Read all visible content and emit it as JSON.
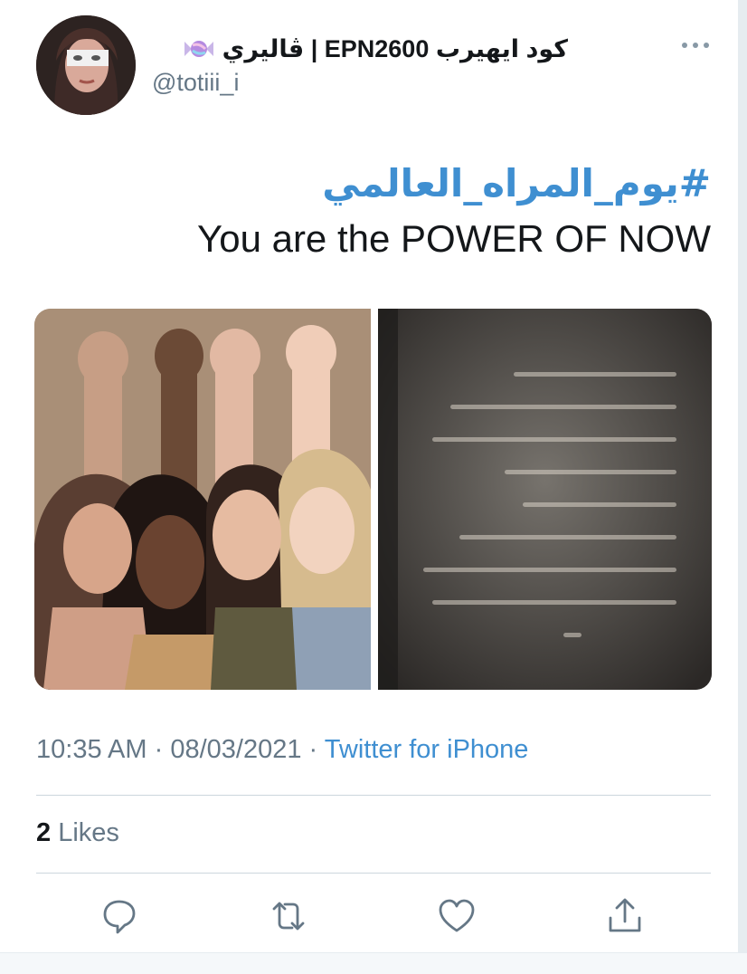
{
  "user": {
    "display_name": "كود ايهيرب EPN2600 | ڤاليري",
    "handle": "@totiii_i"
  },
  "tweet": {
    "hashtag": "#يوم_المراه_العالمي",
    "text": "You are the POWER OF NOW"
  },
  "meta": {
    "time": "10:35 AM",
    "separator": "·",
    "date": "08/03/2021",
    "source": "Twitter for iPhone"
  },
  "stats": {
    "likes_count": "2",
    "likes_label": "Likes"
  },
  "icons": {
    "avatar": "avatar",
    "badge": "candy-icon",
    "more": "more-icon",
    "reply": "reply-icon",
    "retweet": "retweet-icon",
    "like": "like-icon",
    "share": "share-icon"
  },
  "colors": {
    "link": "#3f8fd1",
    "secondary_text": "#657786",
    "primary_text": "#14171a"
  }
}
